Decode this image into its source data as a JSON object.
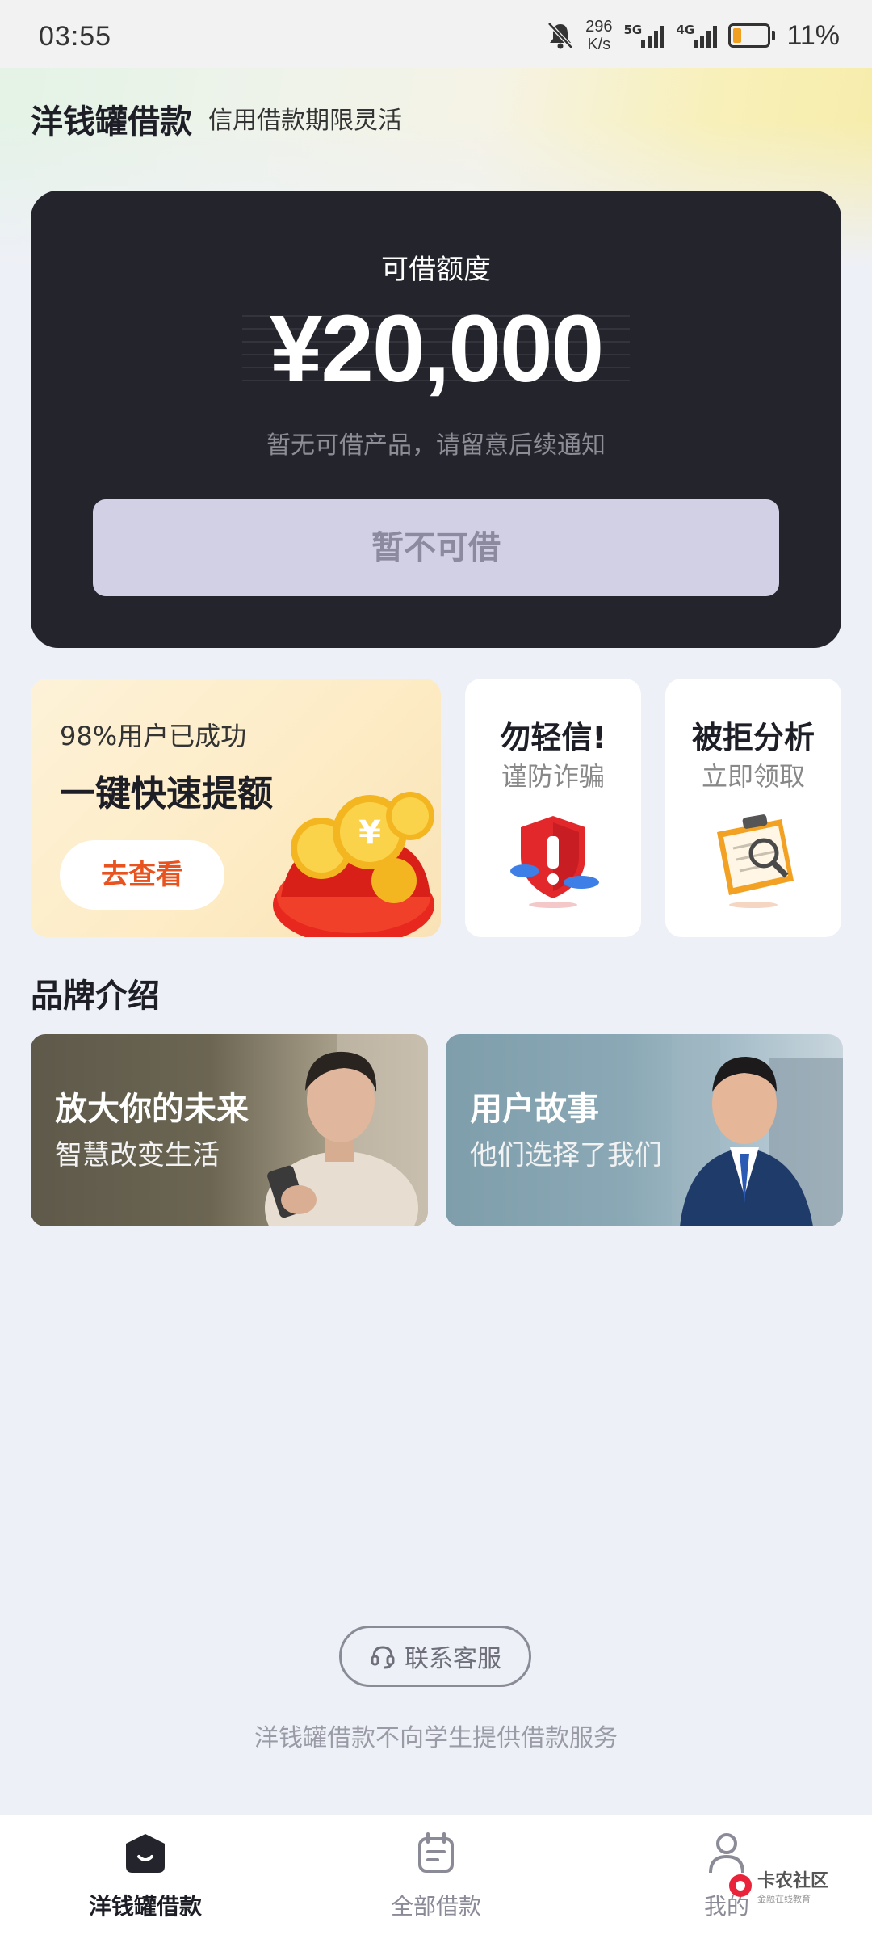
{
  "status_bar": {
    "time": "03:55",
    "net_speed_value": "296",
    "net_speed_unit": "K/s",
    "signal1_label": "5G",
    "signal2_label": "4G",
    "battery": "11%"
  },
  "header": {
    "title": "洋钱罐借款",
    "subtitle": "信用借款期限灵活"
  },
  "credit": {
    "label": "可借额度",
    "amount": "¥20,000",
    "note": "暂无可借产品，请留意后续通知",
    "button": "暂不可借"
  },
  "promo": {
    "subtitle": "98%用户已成功",
    "title": "一键快速提额",
    "button": "去查看"
  },
  "fraud_card": {
    "title": "勿轻信!",
    "subtitle": "谨防诈骗"
  },
  "rejection_card": {
    "title": "被拒分析",
    "subtitle": "立即领取"
  },
  "brand": {
    "section_title": "品牌介绍",
    "cards": [
      {
        "title": "放大你的未来",
        "subtitle": "智慧改变生活"
      },
      {
        "title": "用户故事",
        "subtitle": "他们选择了我们"
      }
    ]
  },
  "service": {
    "contact_label": "联系客服",
    "disclaimer": "洋钱罐借款不向学生提供借款服务"
  },
  "nav": {
    "items": [
      {
        "label": "洋钱罐借款",
        "icon": "home-icon",
        "active": true
      },
      {
        "label": "全部借款",
        "icon": "calendar-list-icon",
        "active": false
      },
      {
        "label": "我的",
        "icon": "user-icon",
        "active": false
      }
    ]
  },
  "watermark": {
    "title": "卡农社区",
    "subtitle": "金融在线教育"
  },
  "colors": {
    "card_dark": "#24252c",
    "accent_orange": "#e8531f",
    "button_disabled": "#d2d0e5",
    "background": "#eef0f7"
  }
}
